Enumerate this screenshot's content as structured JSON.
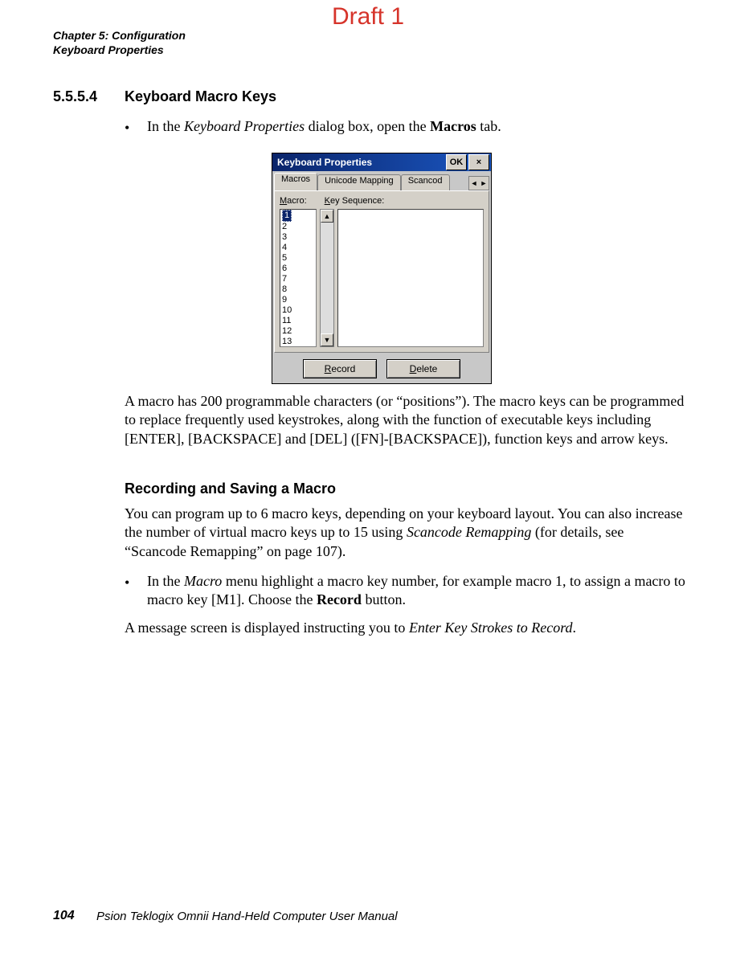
{
  "watermark": "Draft 1",
  "header": {
    "chapter": "Chapter 5: Configuration",
    "section": "Keyboard Properties"
  },
  "heading": {
    "number": "5.5.5.4",
    "title": "Keyboard Macro Keys"
  },
  "bullet1": {
    "pre": "In the ",
    "italic": "Keyboard Properties",
    "mid": " dialog box, open the ",
    "bold": "Macros",
    "post": " tab."
  },
  "dialog": {
    "title": "Keyboard Properties",
    "ok": "OK",
    "close": "×",
    "tabs": {
      "macros": "Macros",
      "unicode": "Unicode Mapping",
      "scancode": "Scancod"
    },
    "spin_left": "◄",
    "spin_right": "►",
    "label_macro_ul": "M",
    "label_macro_rest": "acro:",
    "label_keyseq_ul": "K",
    "label_keyseq_rest": "ey Sequence:",
    "list": {
      "selected": "1",
      "items": [
        "2",
        "3",
        "4",
        "5",
        "6",
        "7",
        "8",
        "9",
        "10",
        "11",
        "12",
        "13"
      ]
    },
    "scroll_up": "▲",
    "scroll_down": "▼",
    "record_ul": "R",
    "record_rest": "ecord",
    "delete_ul": "D",
    "delete_rest": "elete"
  },
  "para1": "A macro has 200 programmable characters (or “positions”). The macro keys can be programmed to replace frequently used keystrokes, along with the function of executable keys including [ENTER], [BACKSPACE] and [DEL] ([FN]-[BACKSPACE]), function keys and arrow keys.",
  "subheading": "Recording and Saving a Macro",
  "para2_a": "You can program up to 6 macro keys, depending on your keyboard layout. You can also increase the number of virtual macro keys up to 15 using ",
  "para2_i": "Scancode Remapping",
  "para2_b": " (for details, see “Scancode Remapping” on page 107).",
  "bullet2": {
    "a": "In the ",
    "i1": "Macro",
    "b": " menu highlight a macro key number, for example macro 1, to assign a macro to macro key [M1]. Choose the ",
    "bold": "Record",
    "c": " button."
  },
  "para3_a": "A message screen is displayed instructing you to ",
  "para3_i": "Enter Key Strokes to Record",
  "para3_b": ".",
  "footer": {
    "page": "104",
    "text": "Psion Teklogix Omnii Hand-Held Computer User Manual"
  }
}
